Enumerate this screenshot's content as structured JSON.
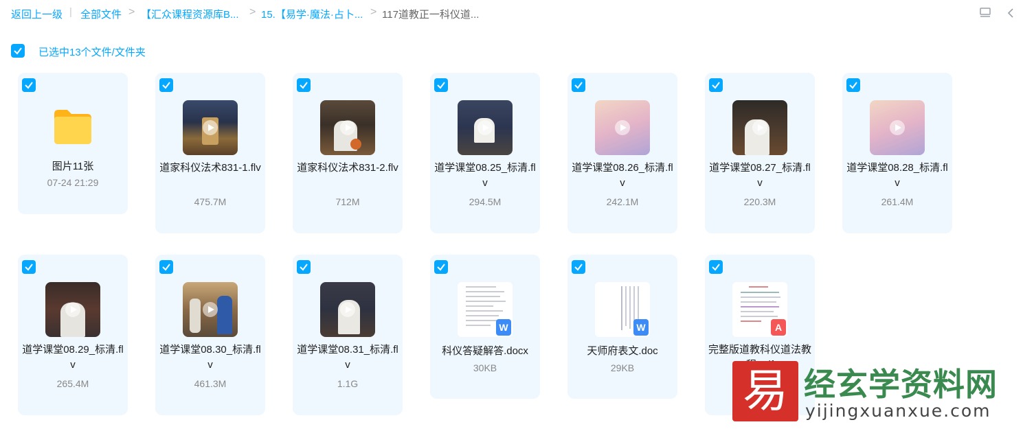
{
  "breadcrumb": {
    "back": "返回上一级",
    "items": [
      "全部文件",
      "【汇众课程资源库B...",
      "15.【易学·魔法·占卜...",
      "117道教正一科仪道..."
    ]
  },
  "toolbar": {
    "icons": [
      "list-view-icon",
      "collapse-chevron-icon"
    ]
  },
  "selection": {
    "label": "已选中13个文件/文件夹",
    "checked": true
  },
  "files": [
    {
      "name": "图片11张",
      "meta": "07-24 21:29",
      "type": "folder"
    },
    {
      "name": "道家科仪法术831-1.flv",
      "meta": "475.7M",
      "type": "video"
    },
    {
      "name": "道家科仪法术831-2.flv",
      "meta": "712M",
      "type": "video"
    },
    {
      "name": "道学课堂08.25_标清.flv",
      "meta": "294.5M",
      "type": "video"
    },
    {
      "name": "道学课堂08.26_标清.flv",
      "meta": "242.1M",
      "type": "video-blank"
    },
    {
      "name": "道学课堂08.27_标清.flv",
      "meta": "220.3M",
      "type": "video"
    },
    {
      "name": "道学课堂08.28_标清.flv",
      "meta": "261.4M",
      "type": "video-blank"
    },
    {
      "name": "道学课堂08.29_标清.flv",
      "meta": "265.4M",
      "type": "video"
    },
    {
      "name": "道学课堂08.30_标清.flv",
      "meta": "461.3M",
      "type": "video"
    },
    {
      "name": "道学课堂08.31_标清.flv",
      "meta": "1.1G",
      "type": "video"
    },
    {
      "name": "科仪答疑解答.docx",
      "meta": "30KB",
      "type": "word"
    },
    {
      "name": "天师府表文.doc",
      "meta": "29KB",
      "type": "word"
    },
    {
      "name": "完整版道教科仪道法教程.pdf",
      "meta": "",
      "type": "pdf"
    }
  ],
  "watermark": {
    "logo_char": "易",
    "title": "经玄学资料网",
    "url": "yijingxuanxue.com"
  },
  "colors": {
    "accent": "#06a7ff",
    "card_bg": "#eff8ff",
    "folder": "#ffc933",
    "word": "#3d8bf7",
    "pdf": "#f55656"
  }
}
